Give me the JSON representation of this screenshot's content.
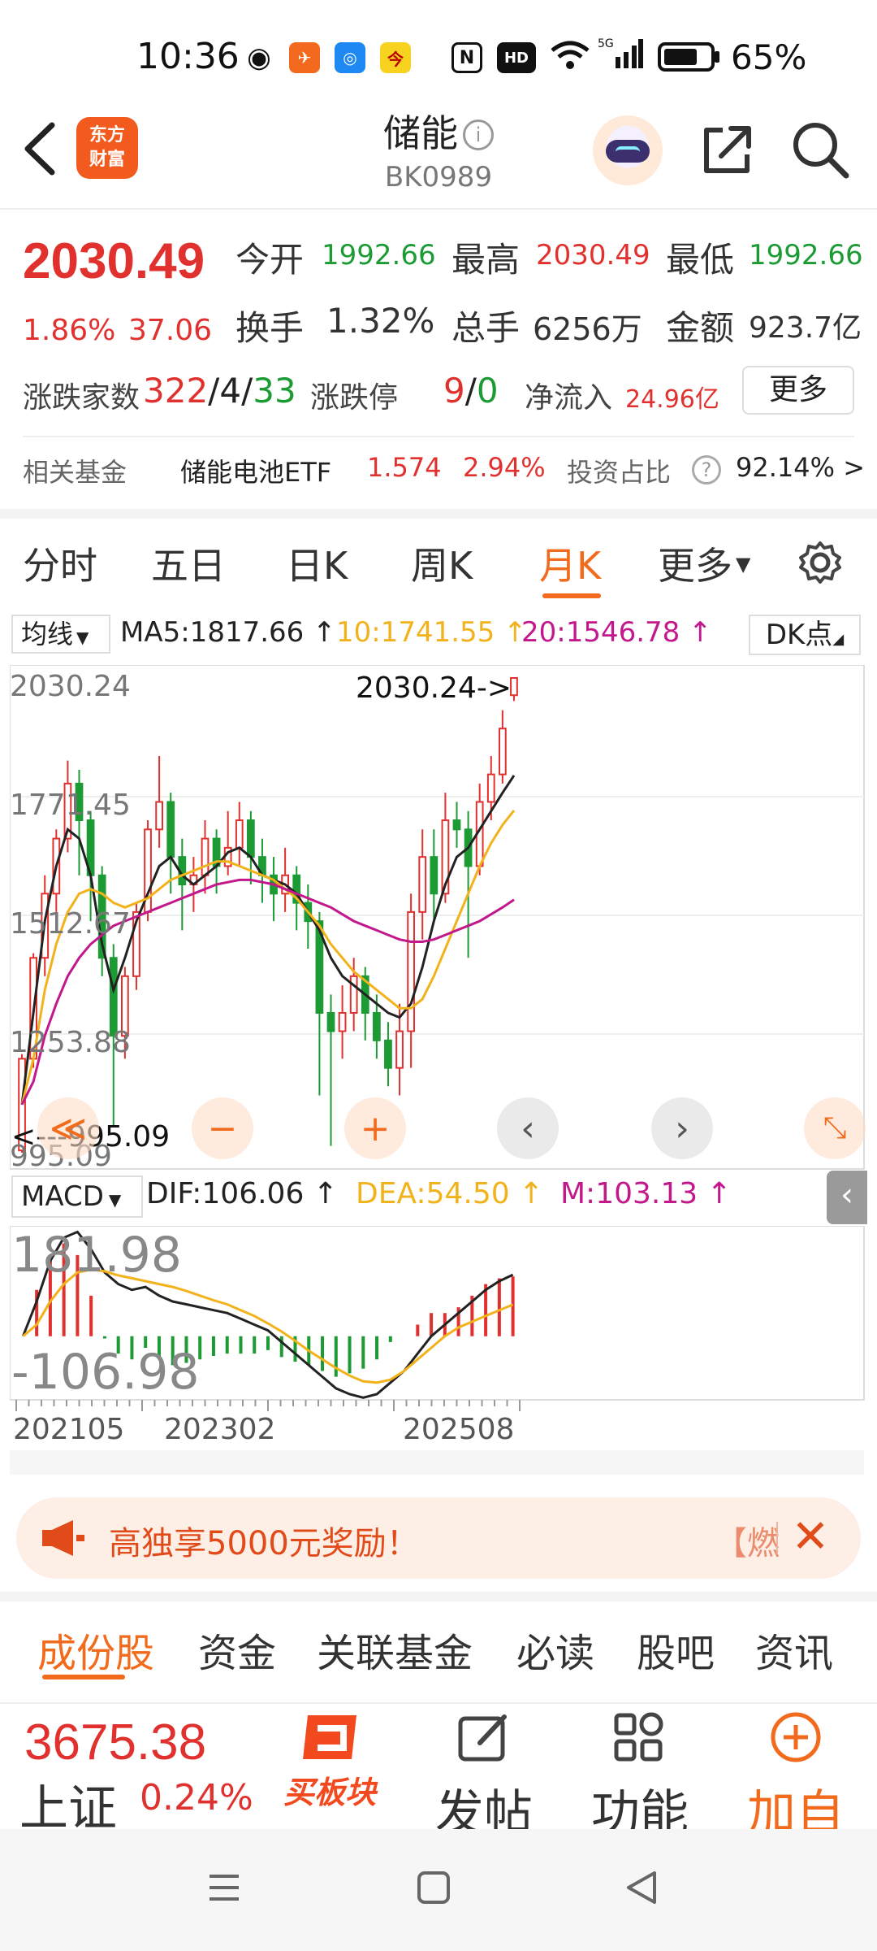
{
  "status_bar": {
    "time": "10:36",
    "battery": "65%",
    "network": "5G"
  },
  "header": {
    "back_icon": "chevron-left-icon",
    "logo_text": "东方\n财富",
    "title": "储能",
    "info_icon": "i",
    "code": "BK0989",
    "assistant_icon": "robot-avatar-icon",
    "share_icon": "share-icon",
    "search_icon": "search-icon"
  },
  "quote": {
    "price": "2030.49",
    "change_pct": "1.86%",
    "change_abs": "37.06",
    "open_label": "今开",
    "open": "1992.66",
    "high_label": "最高",
    "high": "2030.49",
    "low_label": "最低",
    "low": "1992.66",
    "turnover_label": "换手",
    "turnover": "1.32%",
    "volume_label": "总手",
    "volume": "6256万",
    "amount_label": "金额",
    "amount": "923.7亿",
    "adv_dec_label": "涨跌家数",
    "adv": "322",
    "flat": "4",
    "dec": "33",
    "limit_label": "涨跌停",
    "limit_up": "9",
    "limit_down": "0",
    "netflow_label": "净流入",
    "netflow": "24.96亿",
    "more_button": "更多"
  },
  "related_fund": {
    "label": "相关基金",
    "name": "储能电池ETF",
    "price": "1.574",
    "pct": "2.94%",
    "ratio_label": "投资占比",
    "ratio_icon": "?",
    "ratio": "92.14% >"
  },
  "chart_tabs": [
    "分时",
    "五日",
    "日K",
    "周K",
    "月K",
    "更多"
  ],
  "active_chart_tab": "月K",
  "ma_bar": {
    "selector": "均线",
    "ma5": "MA5:1817.66",
    "ma10": "10:1741.55",
    "ma20": "20:1546.78",
    "dk_button": "DK点"
  },
  "macd_bar": {
    "selector": "MACD",
    "dif": "DIF:106.06",
    "dea": "DEA:54.50",
    "m": "M:103.13"
  },
  "colors": {
    "up": "#e0312f",
    "down": "#1c9b35",
    "ma5": "#222222",
    "ma10": "#f2b21b",
    "ma20": "#c2188c",
    "accent": "#f26a1b"
  },
  "chart_data": [
    {
      "type": "candlestick",
      "title": "",
      "y_tick_labels": [
        "2030.24",
        "1771.45",
        "1512.67",
        "1253.88",
        "995.09"
      ],
      "ylim": [
        995.09,
        2030.24
      ],
      "annotations": [
        "2030.24->",
        "<---995.09"
      ],
      "series": [
        {
          "name": "MA5",
          "values": [
            1100,
            1300,
            1500,
            1620,
            1700,
            1680,
            1600,
            1450,
            1350,
            1420,
            1500,
            1560,
            1620,
            1640,
            1600,
            1580,
            1600,
            1620,
            1650,
            1660,
            1640,
            1600,
            1590,
            1580,
            1560,
            1520,
            1480,
            1420,
            1380,
            1360,
            1340,
            1320,
            1300,
            1290,
            1320,
            1400,
            1500,
            1580,
            1640,
            1660,
            1700,
            1740,
            1780,
            1817.66
          ]
        },
        {
          "name": "MA10",
          "values": [
            1100,
            1200,
            1350,
            1450,
            1520,
            1560,
            1570,
            1560,
            1540,
            1530,
            1540,
            1550,
            1570,
            1590,
            1600,
            1610,
            1620,
            1630,
            1630,
            1620,
            1610,
            1600,
            1590,
            1570,
            1550,
            1520,
            1490,
            1450,
            1420,
            1390,
            1370,
            1350,
            1330,
            1310,
            1310,
            1330,
            1380,
            1440,
            1500,
            1560,
            1620,
            1670,
            1710,
            1741.55
          ]
        },
        {
          "name": "MA20",
          "values": [
            1100,
            1150,
            1250,
            1320,
            1380,
            1420,
            1450,
            1470,
            1490,
            1500,
            1510,
            1520,
            1530,
            1540,
            1550,
            1560,
            1570,
            1580,
            1585,
            1590,
            1590,
            1585,
            1580,
            1570,
            1560,
            1550,
            1540,
            1530,
            1515,
            1500,
            1490,
            1480,
            1470,
            1460,
            1455,
            1455,
            1460,
            1470,
            1480,
            1490,
            1500,
            1515,
            1530,
            1546.78
          ]
        }
      ],
      "candles": [
        {
          "o": 1000,
          "c": 1200,
          "h": 1210,
          "l": 995.09
        },
        {
          "o": 1200,
          "c": 1420,
          "h": 1430,
          "l": 1180
        },
        {
          "o": 1420,
          "c": 1560,
          "h": 1600,
          "l": 1380
        },
        {
          "o": 1560,
          "c": 1680,
          "h": 1700,
          "l": 1520
        },
        {
          "o": 1680,
          "c": 1800,
          "h": 1850,
          "l": 1650
        },
        {
          "o": 1800,
          "c": 1720,
          "h": 1830,
          "l": 1600
        },
        {
          "o": 1720,
          "c": 1600,
          "h": 1740,
          "l": 1500
        },
        {
          "o": 1600,
          "c": 1420,
          "h": 1620,
          "l": 1380
        },
        {
          "o": 1420,
          "c": 1250,
          "h": 1450,
          "l": 1050
        },
        {
          "o": 1250,
          "c": 1380,
          "h": 1400,
          "l": 1200
        },
        {
          "o": 1380,
          "c": 1520,
          "h": 1540,
          "l": 1350
        },
        {
          "o": 1520,
          "c": 1700,
          "h": 1720,
          "l": 1500
        },
        {
          "o": 1700,
          "c": 1760,
          "h": 1860,
          "l": 1660
        },
        {
          "o": 1760,
          "c": 1640,
          "h": 1780,
          "l": 1560
        },
        {
          "o": 1640,
          "c": 1580,
          "h": 1680,
          "l": 1480
        },
        {
          "o": 1580,
          "c": 1600,
          "h": 1640,
          "l": 1520
        },
        {
          "o": 1600,
          "c": 1680,
          "h": 1720,
          "l": 1560
        },
        {
          "o": 1680,
          "c": 1620,
          "h": 1700,
          "l": 1560
        },
        {
          "o": 1620,
          "c": 1660,
          "h": 1740,
          "l": 1600
        },
        {
          "o": 1660,
          "c": 1720,
          "h": 1760,
          "l": 1620
        },
        {
          "o": 1720,
          "c": 1640,
          "h": 1740,
          "l": 1580
        },
        {
          "o": 1640,
          "c": 1600,
          "h": 1680,
          "l": 1540
        },
        {
          "o": 1600,
          "c": 1560,
          "h": 1640,
          "l": 1500
        },
        {
          "o": 1560,
          "c": 1600,
          "h": 1660,
          "l": 1520
        },
        {
          "o": 1600,
          "c": 1540,
          "h": 1620,
          "l": 1480
        },
        {
          "o": 1540,
          "c": 1500,
          "h": 1580,
          "l": 1440
        },
        {
          "o": 1500,
          "c": 1300,
          "h": 1520,
          "l": 1120
        },
        {
          "o": 1300,
          "c": 1260,
          "h": 1340,
          "l": 1010
        },
        {
          "o": 1260,
          "c": 1300,
          "h": 1360,
          "l": 1200
        },
        {
          "o": 1300,
          "c": 1380,
          "h": 1420,
          "l": 1260
        },
        {
          "o": 1380,
          "c": 1300,
          "h": 1400,
          "l": 1240
        },
        {
          "o": 1300,
          "c": 1240,
          "h": 1340,
          "l": 1200
        },
        {
          "o": 1240,
          "c": 1180,
          "h": 1280,
          "l": 1140
        },
        {
          "o": 1180,
          "c": 1260,
          "h": 1320,
          "l": 1120
        },
        {
          "o": 1260,
          "c": 1520,
          "h": 1560,
          "l": 1180
        },
        {
          "o": 1520,
          "c": 1640,
          "h": 1700,
          "l": 1460
        },
        {
          "o": 1640,
          "c": 1560,
          "h": 1700,
          "l": 1500
        },
        {
          "o": 1560,
          "c": 1720,
          "h": 1780,
          "l": 1540
        },
        {
          "o": 1720,
          "c": 1700,
          "h": 1760,
          "l": 1660
        },
        {
          "o": 1700,
          "c": 1620,
          "h": 1740,
          "l": 1420
        },
        {
          "o": 1620,
          "c": 1760,
          "h": 1800,
          "l": 1600
        },
        {
          "o": 1760,
          "c": 1820,
          "h": 1860,
          "l": 1720
        },
        {
          "o": 1820,
          "c": 1920,
          "h": 1960,
          "l": 1800
        },
        {
          "o": 1992.66,
          "c": 2030.24,
          "h": 2030.24,
          "l": 1980
        }
      ]
    },
    {
      "type": "bar",
      "title": "MACD",
      "y_tick_labels": [
        "181.98",
        "-106.98"
      ],
      "ylim": [
        -106.98,
        181.98
      ],
      "series": [
        {
          "name": "DIF",
          "values": [
            0,
            60,
            130,
            170,
            180,
            150,
            110,
            90,
            80,
            85,
            70,
            60,
            55,
            50,
            45,
            40,
            30,
            20,
            10,
            -10,
            -30,
            -50,
            -70,
            -90,
            -100,
            -106,
            -100,
            -80,
            -60,
            -30,
            0,
            20,
            40,
            60,
            80,
            95,
            106.06
          ]
        },
        {
          "name": "DEA",
          "values": [
            0,
            20,
            60,
            90,
            110,
            115,
            112,
            105,
            100,
            95,
            90,
            85,
            78,
            70,
            62,
            55,
            45,
            35,
            22,
            8,
            -8,
            -25,
            -40,
            -55,
            -68,
            -78,
            -80,
            -75,
            -60,
            -40,
            -20,
            0,
            15,
            25,
            35,
            45,
            54.5
          ]
        },
        {
          "name": "M",
          "values": [
            0,
            80,
            140,
            160,
            140,
            70,
            -4,
            -30,
            -40,
            -20,
            -40,
            -50,
            -46,
            -40,
            -34,
            -30,
            -30,
            -30,
            -24,
            -36,
            -44,
            -50,
            -60,
            -70,
            -64,
            -56,
            -40,
            -10,
            0,
            20,
            40,
            40,
            50,
            70,
            90,
            100,
            103.13
          ]
        }
      ],
      "x_tick_labels": [
        "202105",
        "202302",
        "202508"
      ]
    }
  ],
  "controls": {
    "fast_back": "≪",
    "zoom_out": "−",
    "zoom_in": "+",
    "prev": "‹",
    "next": "›",
    "fullscreen": "⤡",
    "collapse": "‹"
  },
  "banner": {
    "text": "高独享5000元奖励！",
    "tail": "【燃",
    "close": "✕"
  },
  "bottom_tabs": [
    "成份股",
    "资金",
    "关联基金",
    "必读",
    "股吧",
    "资讯"
  ],
  "active_bottom_tab": "成份股",
  "toolbar": {
    "index_value": "3675.38",
    "index_name": "上证",
    "index_pct": "0.24%",
    "buy_label": "买板块",
    "post_label": "发帖",
    "func_label": "功能",
    "add_label": "加自"
  }
}
